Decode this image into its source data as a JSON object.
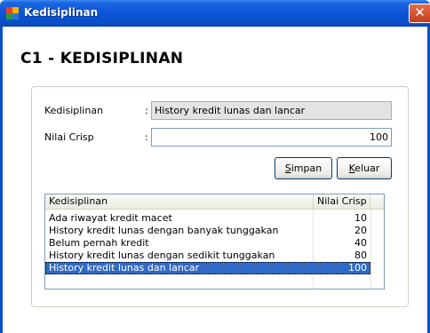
{
  "window": {
    "title": "Kedisiplinan",
    "close_glyph": "✕"
  },
  "heading": "C1 - KEDISIPLINAN",
  "form": {
    "kedisiplinan_label": "Kedisiplinan",
    "kedisiplinan_value": "History kredit lunas dan lancar",
    "nilai_label": "Nilai Crisp",
    "nilai_value": "100",
    "colon": ":"
  },
  "buttons": {
    "simpan": {
      "mnemonic": "S",
      "rest": "impan"
    },
    "keluar": {
      "mnemonic": "K",
      "rest": "eluar"
    }
  },
  "table": {
    "columns": [
      "Kedisiplinan",
      "Nilai Crisp"
    ],
    "rows": [
      {
        "kedisiplinan": "Ada riwayat kredit macet",
        "nilai": "10"
      },
      {
        "kedisiplinan": "History kredit lunas dengan banyak tunggakan",
        "nilai": "20"
      },
      {
        "kedisiplinan": "Belum pernah kredit",
        "nilai": "40"
      },
      {
        "kedisiplinan": "History kredit lunas dengan sedikit tunggakan",
        "nilai": "80"
      },
      {
        "kedisiplinan": "History kredit lunas dan lancar",
        "nilai": "100",
        "selected": true
      }
    ]
  },
  "colors": {
    "titlebar": "#0a54d6",
    "selection": "#316ac5",
    "close_button": "#d9532c"
  },
  "icons": {
    "app": "app-window-icon",
    "close": "close-icon"
  }
}
